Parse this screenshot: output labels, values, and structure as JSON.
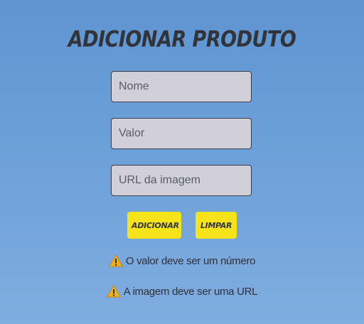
{
  "form": {
    "title": "Adicionar Produto",
    "name_placeholder": "Nome",
    "value_placeholder": "Valor",
    "url_placeholder": "URL da imagem",
    "add_label": "Adicionar",
    "clear_label": "Limpar"
  },
  "warnings": {
    "icon": "warning-icon",
    "value_message": "O valor deve ser um número",
    "url_message": "A imagem deve ser uma URL"
  },
  "colors": {
    "background_top": "#5e95d1",
    "background_bottom": "#80ade0",
    "input_background": "#d1d0d8",
    "button_background": "#f7e31a",
    "text_dark": "#33343a"
  }
}
